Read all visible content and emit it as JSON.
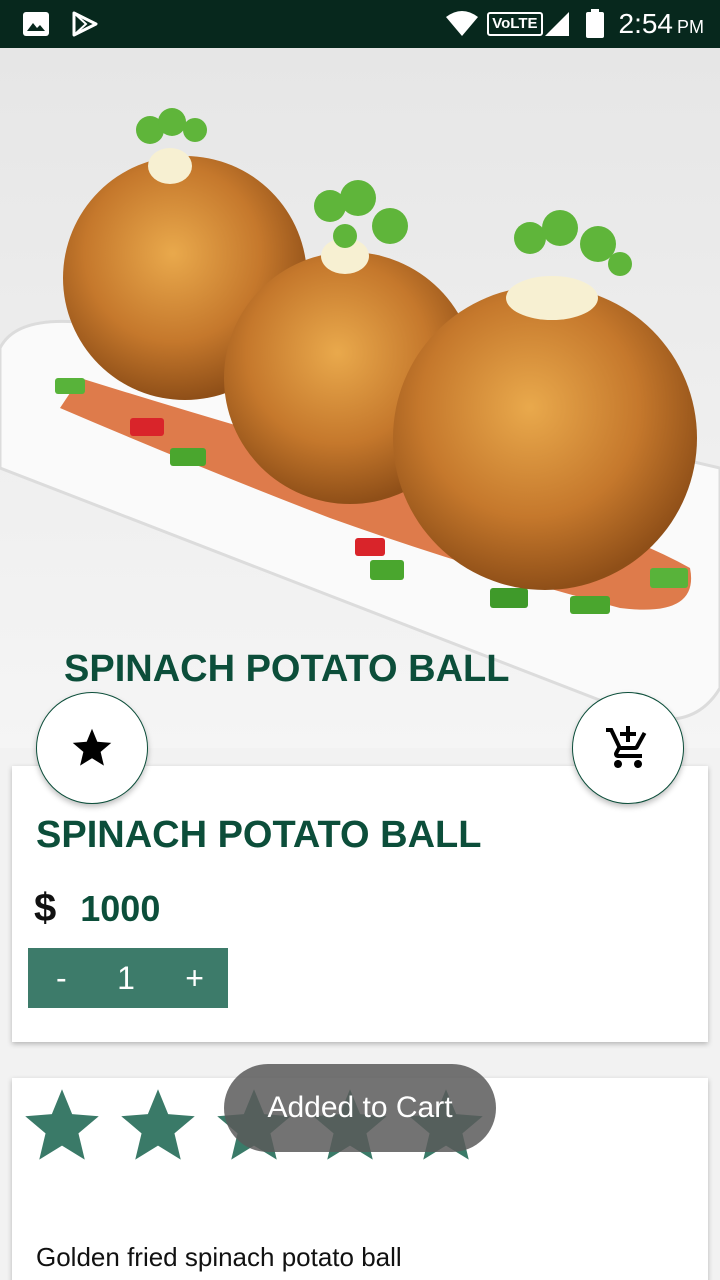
{
  "status_bar": {
    "network": "VoLTE",
    "time": "2:54",
    "meridiem": "PM"
  },
  "hero": {
    "image": "spinach-potato-balls-photo",
    "title": "SPINACH POTATO BALL"
  },
  "actions": {
    "favorite_icon": "star-icon",
    "cart_icon": "add-shopping-cart-icon"
  },
  "product": {
    "name": "SPINACH POTATO BALL",
    "currency": "$",
    "price": "1000",
    "quantity": {
      "decrement": "-",
      "value": "1",
      "increment": "+"
    }
  },
  "rating": {
    "stars": 5,
    "color": "#3a7a68"
  },
  "description": "Golden fried spinach potato ball",
  "toast": "Added to Cart",
  "colors": {
    "primary": "#0c4e3a",
    "accent": "#3d7b6a",
    "status_bar": "#07281d"
  }
}
